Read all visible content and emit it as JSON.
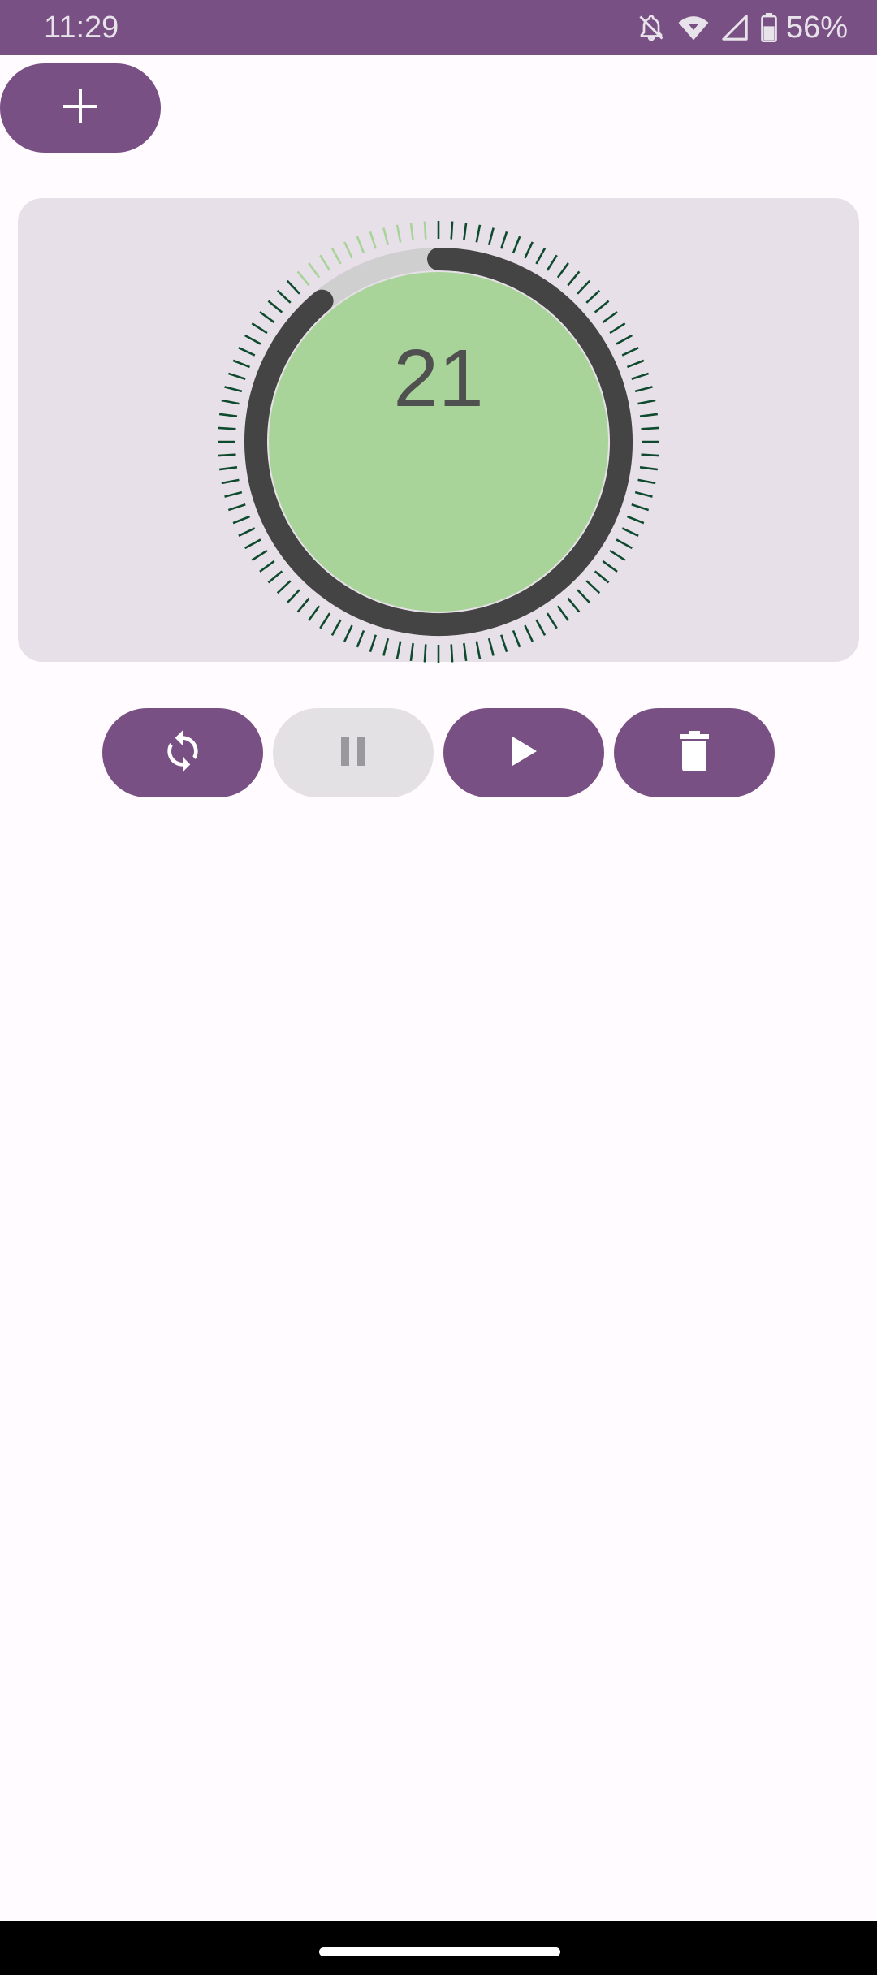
{
  "status_bar": {
    "time": "11:29",
    "battery": "56%",
    "icons": [
      "notifications-off-icon",
      "wifi-icon",
      "signal-icon",
      "battery-icon"
    ]
  },
  "toolbar": {
    "add_icon": "plus-icon"
  },
  "timer": {
    "value": "21",
    "progress_fraction": 0.89,
    "colors": {
      "face": "#a8d49a",
      "progress_arc": "#444444",
      "track": "#cfcfcf",
      "ticks_done": "#0e4a2e",
      "ticks_pending": "#a8d49a"
    }
  },
  "controls": [
    {
      "name": "restart-button",
      "icon": "sync-icon",
      "enabled": true
    },
    {
      "name": "pause-button",
      "icon": "pause-icon",
      "enabled": false
    },
    {
      "name": "play-button",
      "icon": "play-icon",
      "enabled": true
    },
    {
      "name": "delete-button",
      "icon": "trash-icon",
      "enabled": true
    }
  ],
  "theme": {
    "primary": "#785083",
    "background": "#fffbfe",
    "card": "#e8e0e8"
  }
}
